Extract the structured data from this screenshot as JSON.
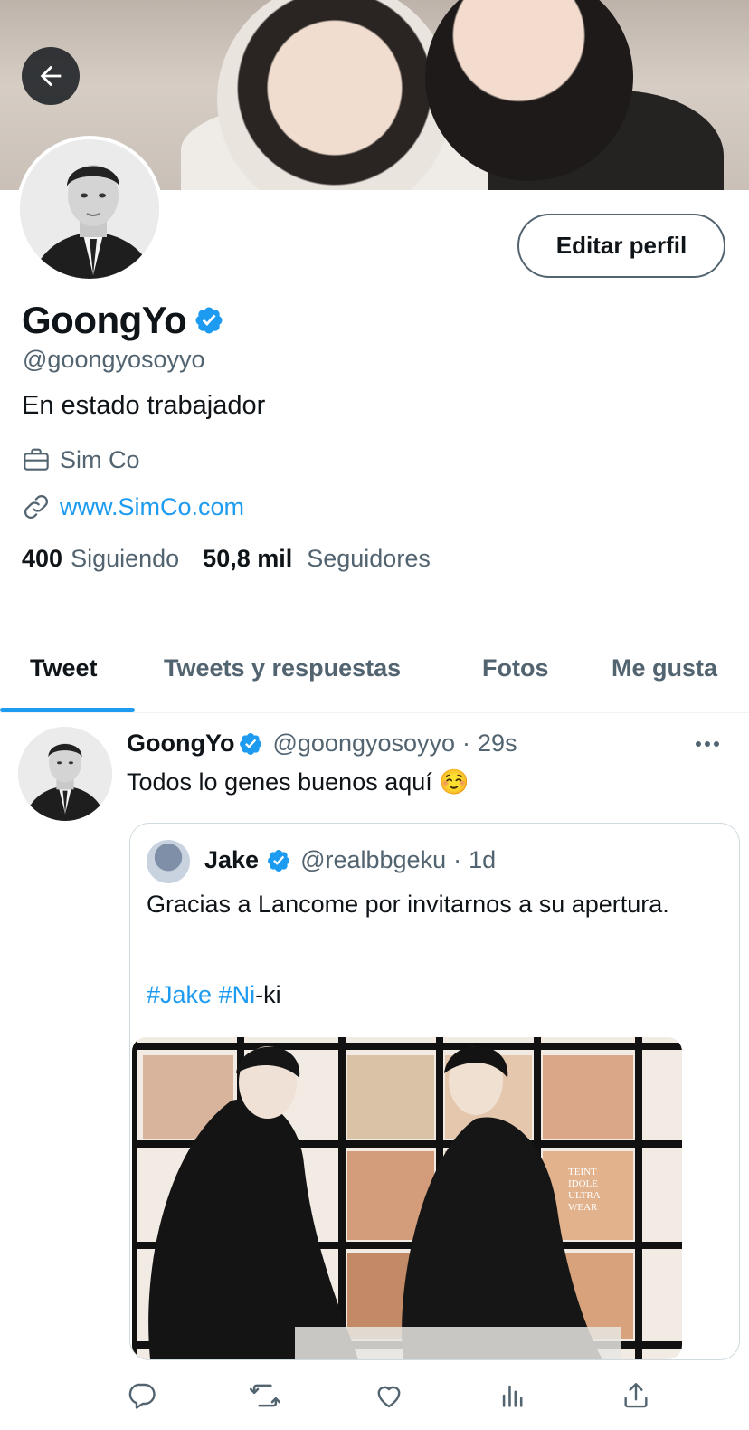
{
  "profile": {
    "display_name": "GoongYo",
    "handle": "@goongyosoyyo",
    "bio": "En estado trabajador",
    "work": "Sim Co",
    "website": "www.SimCo.com",
    "following_count": "400",
    "following_label": "Siguiendo",
    "followers_count": "50,8 mil",
    "followers_label": "Seguidores",
    "edit_button_label": "Editar perfil",
    "verified": true
  },
  "tabs": [
    {
      "label": "Tweet",
      "active": true
    },
    {
      "label": "Tweets y respuestas",
      "active": false
    },
    {
      "label": "Fotos",
      "active": false
    },
    {
      "label": "Me gusta",
      "active": false
    }
  ],
  "tweet": {
    "author_name": "GoongYo",
    "author_handle": "@goongyosoyyo",
    "separator": "·",
    "time": "29s",
    "text": "Todos lo genes buenos aquí ☺️",
    "more_icon": "more-horizontal-icon",
    "quote": {
      "author_name": "Jake",
      "author_handle": "@realbbgeku",
      "time": "1d",
      "text": "Gracias a Lancome por invitarnos a su apertura.",
      "hashtag_1": "#Jake",
      "hashtag_2": "#Ni",
      "tag_suffix": "-ki",
      "media_text_1": "TEINT\nIDOLE\nULTRA\nWEAR"
    }
  },
  "icons": {
    "back": "arrow-left-icon",
    "verified": "verified-badge-icon",
    "work": "briefcase-icon",
    "link": "link-icon",
    "reply": "reply-icon",
    "retweet": "retweet-icon",
    "like": "heart-icon",
    "views": "analytics-icon",
    "share": "share-icon"
  },
  "colors": {
    "accent": "#1d9bf0",
    "text_primary": "#0f1419",
    "text_secondary": "#536471",
    "border": "#cfd9de"
  }
}
